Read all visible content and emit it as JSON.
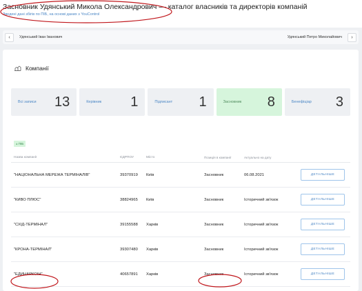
{
  "header": {
    "title": "Засновник Удянський Микола Олександрович — каталог власників та директорів компаній",
    "subtitle": "Зведені дані збігів по ПІБ, на основі даних з YouControl"
  },
  "nav": {
    "prev_icon": "chevron-left-icon",
    "prev_label": "Удянський Іван Іванович",
    "next_label": "Удянський Петро Миколайович",
    "next_icon": "chevron-right-icon"
  },
  "section": {
    "icon": "companies-icon",
    "title": "Компанії"
  },
  "stats": [
    {
      "label": "Всі записи",
      "value": "13",
      "active": false
    },
    {
      "label": "Керівник",
      "value": "1",
      "active": false
    },
    {
      "label": "Підписант",
      "value": "1",
      "active": false
    },
    {
      "label": "Засновник",
      "value": "8",
      "active": true
    },
    {
      "label": "Бенефіціар",
      "value": "3",
      "active": false
    }
  ],
  "filter_chip": "± ПІБ",
  "table": {
    "columns": [
      "Назва компанії",
      "ЄДРПОУ",
      "Місто",
      "Позиція в компанії",
      "Актуально на дату",
      ""
    ],
    "rows": [
      {
        "name": "\"НАЦІОНАЛЬНА МЕРЕЖА ТЕРМІНАЛІВ\"",
        "code": "39370919",
        "city": "Київ",
        "position": "Засновник",
        "date": "06.08.2021",
        "action": "ДЕТАЛЬНІШЕ"
      },
      {
        "name": "\"КИВО ПЛЮС\"",
        "code": "38824965",
        "city": "Київ",
        "position": "Засновник",
        "date": "Історичний зв'язок",
        "action": "ДЕТАЛЬНІШЕ"
      },
      {
        "name": "\"СХІД-ТЕРМІНАЛ\"",
        "code": "39155588",
        "city": "Харків",
        "position": "Засновник",
        "date": "Історичний зв'язок",
        "action": "ДЕТАЛЬНІШЕ"
      },
      {
        "name": "\"КРОНА-ТЕРМІНАЛ\"",
        "code": "39307480",
        "city": "Харків",
        "position": "Засновник",
        "date": "Історичний зв'язок",
        "action": "ДЕТАЛЬНІШЕ"
      },
      {
        "name": "\"ЕДИНАРКОІН\"",
        "code": "40657891",
        "city": "Харків",
        "position": "Засновник",
        "date": "Історичний зв'язок",
        "action": "ДЕТАЛЬНІШЕ"
      }
    ]
  },
  "colors": {
    "accent": "#4a86c5",
    "active_stat": "#d6f5dc",
    "annotation": "#c0161b"
  }
}
